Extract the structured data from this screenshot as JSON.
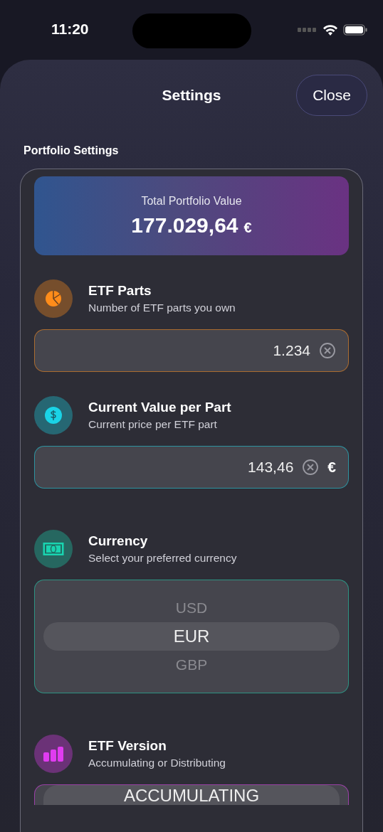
{
  "status_bar": {
    "time": "11:20"
  },
  "header": {
    "title": "Settings",
    "close_button": "Close"
  },
  "section_title": "Portfolio Settings",
  "total": {
    "label": "Total Portfolio Value",
    "amount": "177.029,64",
    "currency": "€"
  },
  "settings": [
    {
      "kind": "field",
      "color": "#ff8c1a",
      "title": "ETF Parts",
      "subtitle": "Number of ETF parts you own",
      "value": "1.234"
    },
    {
      "kind": "field",
      "color": "#1ad3e6",
      "title": "Current Value per Part",
      "subtitle": "Current price per ETF part",
      "value": "143,46",
      "unit": "€"
    },
    {
      "kind": "picker",
      "color": "#19d4b0",
      "title": "Currency",
      "subtitle": "Select your preferred currency",
      "options": [
        {
          "label": "USD",
          "selected": false
        },
        {
          "label": "EUR",
          "selected": true
        },
        {
          "label": "GBP",
          "selected": false
        }
      ]
    },
    {
      "kind": "picker",
      "color": "#e03cf0",
      "title": "ETF Version",
      "subtitle": "Accumulating or Distributing",
      "options": [
        {
          "label": "ACCUMULATING",
          "selected": true
        }
      ]
    }
  ]
}
